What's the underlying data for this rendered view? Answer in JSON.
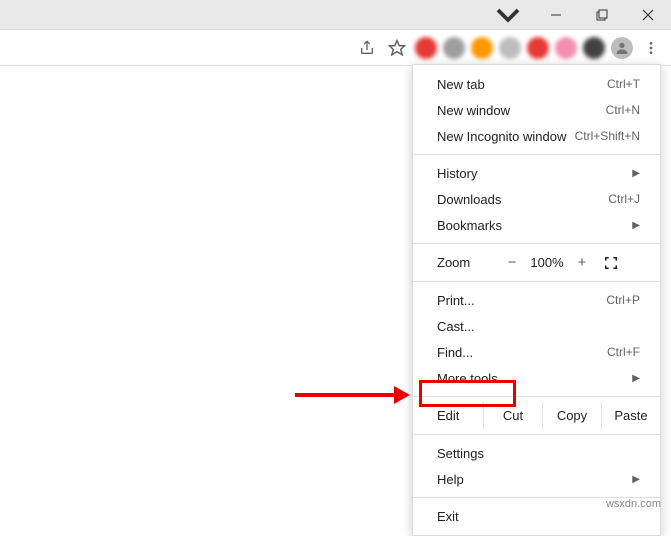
{
  "menu": {
    "new_tab": {
      "label": "New tab",
      "shortcut": "Ctrl+T"
    },
    "new_window": {
      "label": "New window",
      "shortcut": "Ctrl+N"
    },
    "new_incognito": {
      "label": "New Incognito window",
      "shortcut": "Ctrl+Shift+N"
    },
    "history": {
      "label": "History"
    },
    "downloads": {
      "label": "Downloads",
      "shortcut": "Ctrl+J"
    },
    "bookmarks": {
      "label": "Bookmarks"
    },
    "zoom": {
      "label": "Zoom",
      "value": "100%",
      "minus": "−",
      "plus": "+"
    },
    "print": {
      "label": "Print...",
      "shortcut": "Ctrl+P"
    },
    "cast": {
      "label": "Cast..."
    },
    "find": {
      "label": "Find...",
      "shortcut": "Ctrl+F"
    },
    "more_tools": {
      "label": "More tools"
    },
    "edit": {
      "label": "Edit",
      "cut": "Cut",
      "copy": "Copy",
      "paste": "Paste"
    },
    "settings": {
      "label": "Settings"
    },
    "help": {
      "label": "Help"
    },
    "exit": {
      "label": "Exit"
    }
  },
  "extensions": [
    {
      "color": "#e53935"
    },
    {
      "color": "#9e9e9e"
    },
    {
      "color": "#ff9800"
    },
    {
      "color": "#bdbdbd"
    },
    {
      "color": "#e53935"
    },
    {
      "color": "#f48fb1"
    },
    {
      "color": "#424242"
    }
  ],
  "watermark": "wsxdn.com"
}
